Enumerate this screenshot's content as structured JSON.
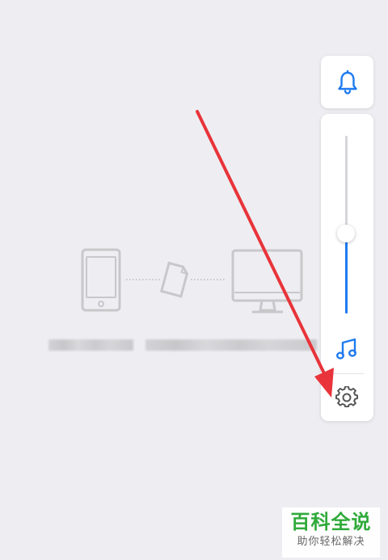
{
  "volume": {
    "level": 0.45
  },
  "icons": {
    "bell": "bell-icon",
    "music": "music-note-icon",
    "settings": "gear-icon",
    "phone": "phone-icon",
    "file": "file-icon",
    "monitor": "monitor-icon"
  },
  "colors": {
    "accent": "#1f7bf0",
    "arrow": "#e8343a",
    "gear": "#555555",
    "watermark_green": "#2faa3a"
  },
  "watermark": {
    "title": "百科全说",
    "subtitle": "助你轻松解决"
  }
}
